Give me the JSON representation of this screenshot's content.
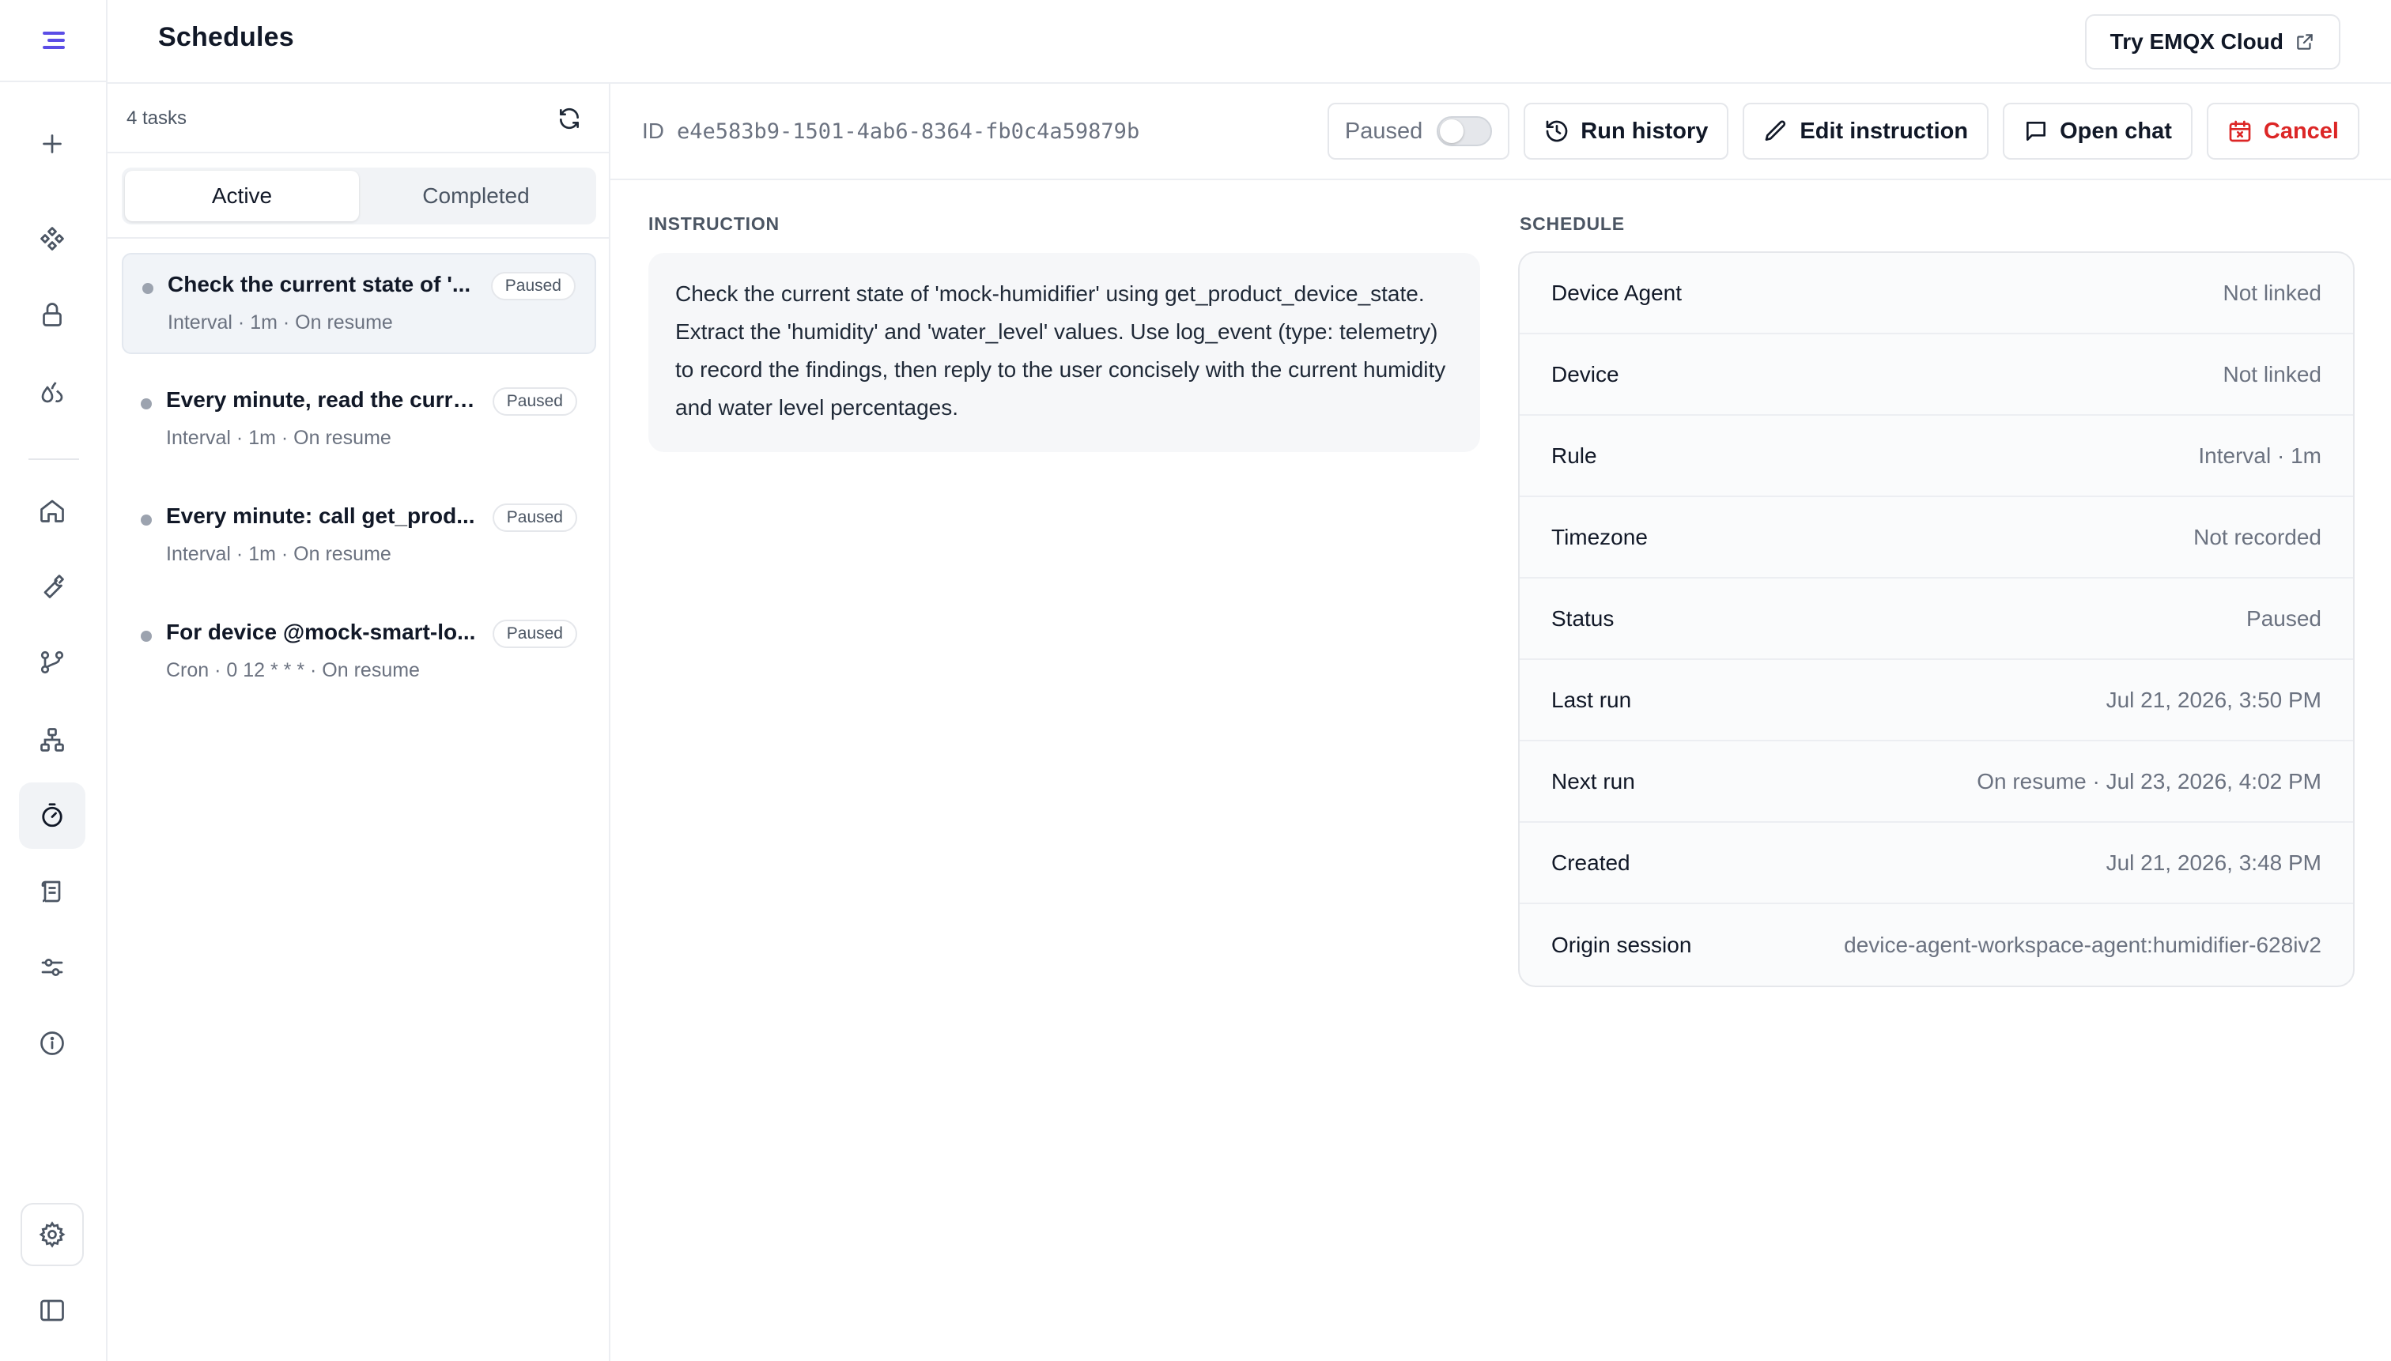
{
  "header": {
    "title": "Schedules",
    "cloud_button": "Try EMQX Cloud"
  },
  "rail": {
    "icons": [
      "menu-logo-icon",
      "plus-icon",
      "integrations-icon",
      "lock-icon",
      "droplets-icon",
      "home-icon",
      "wrench-icon",
      "git-branch-icon",
      "network-icon",
      "timer-icon",
      "scroll-icon",
      "sliders-icon",
      "info-icon",
      "gear-icon",
      "sidebar-toggle-icon"
    ],
    "active": "timer-icon"
  },
  "tasks": {
    "count_label": "4 tasks",
    "tabs": {
      "active": "Active",
      "completed": "Completed"
    },
    "items": [
      {
        "title": "Check the current state of '...",
        "meta": "Interval · 1m · On resume",
        "badge": "Paused"
      },
      {
        "title": "Every minute, read the curre...",
        "meta": "Interval · 1m · On resume",
        "badge": "Paused"
      },
      {
        "title": "Every minute: call get_prod...",
        "meta": "Interval · 1m · On resume",
        "badge": "Paused"
      },
      {
        "title": "For device @mock-smart-lo...",
        "meta": "Cron · 0 12 * * * · On resume",
        "badge": "Paused"
      }
    ]
  },
  "detail": {
    "id_label": "ID",
    "id_value": "e4e583b9-1501-4ab6-8364-fb0c4a59879b",
    "toggle_label": "Paused",
    "toggle_on": false,
    "actions": {
      "run_history": "Run history",
      "edit_instruction": "Edit instruction",
      "open_chat": "Open chat",
      "cancel": "Cancel"
    },
    "instruction_label": "INSTRUCTION",
    "instruction_text": "Check the current state of 'mock-humidifier' using get_product_device_state. Extract the 'humidity' and 'water_level' values. Use log_event (type: telemetry) to record the findings, then reply to the user concisely with the current humidity and water level percentages.",
    "schedule_label": "SCHEDULE",
    "schedule": [
      {
        "key": "Device Agent",
        "value": "Not linked"
      },
      {
        "key": "Device",
        "value": "Not linked"
      },
      {
        "key": "Rule",
        "value": "Interval · 1m"
      },
      {
        "key": "Timezone",
        "value": "Not recorded"
      },
      {
        "key": "Status",
        "value": "Paused"
      },
      {
        "key": "Last run",
        "value": "Jul 21, 2026, 3:50 PM"
      },
      {
        "key": "Next run",
        "value": "On resume · Jul 23, 2026, 4:02 PM"
      },
      {
        "key": "Created",
        "value": "Jul 21, 2026, 3:48 PM"
      },
      {
        "key": "Origin session",
        "value": "device-agent-workspace-agent:humidifier-628iv2"
      }
    ]
  },
  "colors": {
    "accent": "#5b4de6",
    "danger": "#dc2626",
    "muted": "#6b7280"
  }
}
